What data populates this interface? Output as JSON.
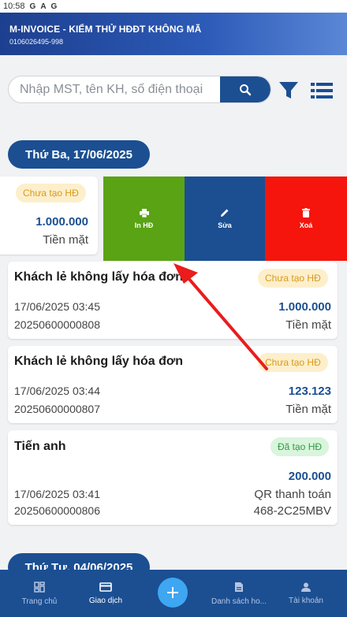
{
  "status_bar": {
    "time": "10:58",
    "icons": [
      "G",
      "A",
      "G"
    ]
  },
  "header": {
    "title": "M-INVOICE - KIỂM THỬ HĐĐT KHÔNG MÃ",
    "tax_code": "0106026495-998"
  },
  "search": {
    "placeholder": "Nhập MST, tên KH, số điện thoại"
  },
  "groups": [
    {
      "date_label": "Thứ Ba, 17/06/2025",
      "swiped_item": {
        "status": "Chưa tạo HĐ",
        "amount": "1.000.000",
        "payment": "Tiền mặt"
      },
      "actions": [
        {
          "label": "In HĐ",
          "icon": "print-icon",
          "color": "#59a315"
        },
        {
          "label": "Sửa",
          "icon": "edit-icon",
          "color": "#1b4f92"
        },
        {
          "label": "Xoá",
          "icon": "delete-icon",
          "color": "#f5150c"
        }
      ],
      "items": [
        {
          "customer": "Khách lẻ không lấy hóa đơn",
          "status": "Chưa tạo HĐ",
          "datetime": "17/06/2025 03:45",
          "code": "20250600000808",
          "amount": "1.000.000",
          "payment": "Tiền mặt"
        },
        {
          "customer": "Khách lẻ không lấy hóa đơn",
          "status": "Chưa tạo HĐ",
          "datetime": "17/06/2025 03:44",
          "code": "20250600000807",
          "amount": "123.123",
          "payment": "Tiền mặt"
        },
        {
          "customer": "Tiến anh",
          "status": "Đã tạo HĐ",
          "datetime": "17/06/2025 03:41",
          "code": "20250600000806",
          "amount": "200.000",
          "payment": "QR thanh toán",
          "extra": "468-2C25MBV"
        }
      ]
    },
    {
      "date_label": "Thứ Tư, 04/06/2025"
    }
  ],
  "bottom_nav": [
    {
      "label": "Trang chủ",
      "icon": "dashboard-icon",
      "active": false
    },
    {
      "label": "Giao dịch",
      "icon": "card-icon",
      "active": true
    },
    {
      "label": "",
      "icon": "add-icon"
    },
    {
      "label": "Danh sách ho...",
      "icon": "document-icon",
      "active": false
    },
    {
      "label": "Tài khoản",
      "icon": "person-icon",
      "active": false
    }
  ],
  "colors": {
    "primary": "#1b4f92",
    "print": "#59a315",
    "delete": "#f5150c",
    "pending_bg": "#fdefcb",
    "pending_text": "#d99a1a",
    "done_bg": "#d9f5dc",
    "done_text": "#2f9a44",
    "fab": "#3fa6f2",
    "annotation_arrow": "#ea1c1c"
  }
}
